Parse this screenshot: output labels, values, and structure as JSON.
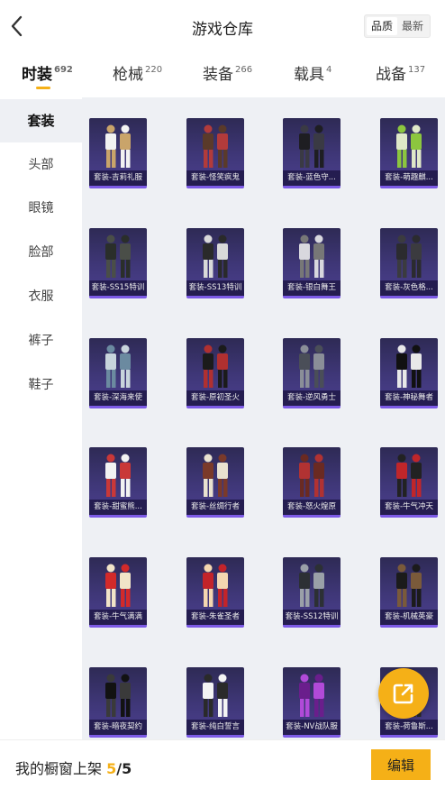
{
  "header": {
    "title": "游戏仓库",
    "sort_options": [
      "品质",
      "最新"
    ],
    "selected_sort": "品质"
  },
  "tabs": [
    {
      "label": "时装",
      "count": "692",
      "active": true
    },
    {
      "label": "枪械",
      "count": "220",
      "active": false
    },
    {
      "label": "装备",
      "count": "266",
      "active": false
    },
    {
      "label": "载具",
      "count": "4",
      "active": false
    },
    {
      "label": "战备",
      "count": "137",
      "active": false
    }
  ],
  "sidebar": {
    "items": [
      {
        "label": "套装",
        "active": true
      },
      {
        "label": "头部",
        "active": false
      },
      {
        "label": "眼镜",
        "active": false
      },
      {
        "label": "脸部",
        "active": false
      },
      {
        "label": "衣服",
        "active": false
      },
      {
        "label": "裤子",
        "active": false
      },
      {
        "label": "鞋子",
        "active": false
      }
    ]
  },
  "items": [
    "套装-吉莉礼服",
    "套装-怪笑疯鬼",
    "套装-蓝色守...",
    "套装-萌趣麒...",
    "套装-SS15特训",
    "套装-SS13特训",
    "套装-银白舞王",
    "套装-灰色格...",
    "套装-深海来使",
    "套装-原初圣火",
    "套装-逆风勇士",
    "套装-神秘舞者",
    "套装-甜蜜熊...",
    "套装-丝绸行者",
    "套装-怒火煌原",
    "套装-牛气冲天",
    "套装-牛气满满",
    "套装-朱雀圣者",
    "套装-SS12特训",
    "套装-机械英豪",
    "套装-暗夜契约",
    "套装-纯白誓言",
    "套装-NV战队服",
    "套装-荷鲁斯..."
  ],
  "footer": {
    "label": "我的橱窗上架",
    "count": "5",
    "separator": "/",
    "total": "5",
    "edit_label": "编辑"
  },
  "colors": {
    "accent": "#f5b017",
    "card_bg": "#3f3778",
    "grid_bg": "#eef0f4"
  },
  "icons": {
    "back": "chevron-left-icon",
    "share": "share-external-icon"
  }
}
